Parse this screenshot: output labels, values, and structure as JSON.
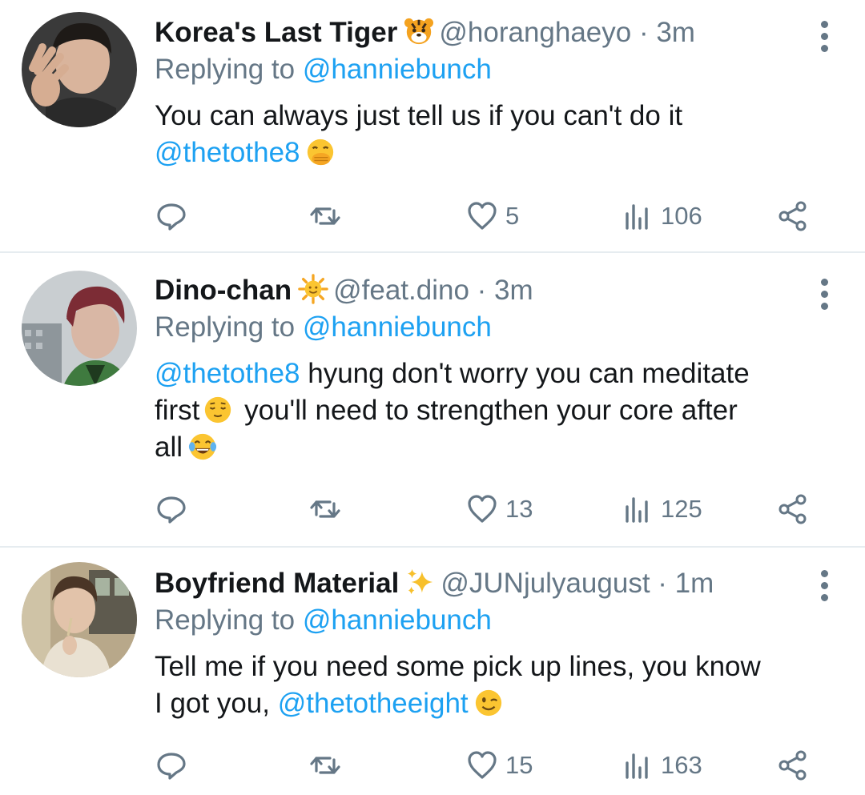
{
  "colors": {
    "link": "#1da1f2",
    "secondary": "#657786",
    "divider": "#e6ecf0"
  },
  "tweets": [
    {
      "name": "Korea's Last Tiger",
      "badge_icon": "tiger-face-emoji",
      "handle": "@horanghaeyo",
      "time": "3m",
      "replying_prefix": "Replying to",
      "replying_to": "@hanniebunch",
      "text_line1": "You can always just tell us if you can't do it",
      "mention": "@thetothe8",
      "end_emoji": "face-with-hand-over-mouth-emoji",
      "likes": "5",
      "views": "106"
    },
    {
      "name": "Dino-chan",
      "badge_icon": "sun-with-face-emoji",
      "handle": "@feat.dino",
      "time": "3m",
      "replying_prefix": "Replying to",
      "replying_to": "@hanniebunch",
      "mention": "@thetothe8",
      "text_a": " hyung don't worry you can meditate",
      "text_b": "first",
      "mid_emoji": "relieved-face-emoji",
      "text_c": " you'll need to strengthen your core after",
      "text_d": "all",
      "end_emoji": "face-with-tears-of-joy-emoji",
      "likes": "13",
      "views": "125"
    },
    {
      "name": "Boyfriend Material",
      "badge_icon": "sparkles-emoji",
      "handle": "@JUNjulyaugust",
      "time": "1m",
      "replying_prefix": "Replying to",
      "replying_to": "@hanniebunch",
      "text_line1": "Tell me if you need some pick up lines, you know",
      "text_line2": "I got you, ",
      "mention": "@thetotheeight",
      "end_emoji": "winking-face-emoji",
      "likes": "15",
      "views": "163"
    }
  ]
}
